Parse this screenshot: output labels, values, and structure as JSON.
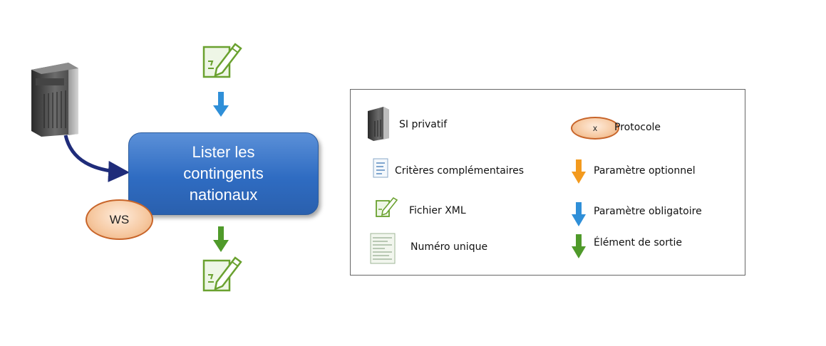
{
  "process": {
    "title": "Lister les contingents nationaux"
  },
  "protocol_badge": {
    "label": "WS"
  },
  "legend": {
    "items": [
      {
        "label": "SI privatif",
        "icon": "server-icon"
      },
      {
        "label": "Protocole",
        "icon": "protocol-ellipse-icon",
        "marker": "x"
      },
      {
        "label": "Critères  complémentaires",
        "icon": "criteria-document-icon"
      },
      {
        "label": "Paramètre optionnel",
        "icon": "orange-arrow-icon"
      },
      {
        "label": "Fichier XML",
        "icon": "xml-file-icon"
      },
      {
        "label": "Paramètre obligatoire",
        "icon": "blue-arrow-icon"
      },
      {
        "label": "Numéro unique",
        "icon": "unique-number-icon"
      },
      {
        "label": "Élément de sortie",
        "icon": "green-arrow-icon"
      }
    ]
  },
  "colors": {
    "process_fill": "#2f6cc2",
    "mandatory_arrow": "#2f8fd8",
    "optional_arrow": "#f39a1e",
    "output_arrow": "#4f9a2a",
    "connector": "#1f2c7a",
    "protocol_fill": "#f6c8a0",
    "protocol_border": "#c8652a"
  }
}
